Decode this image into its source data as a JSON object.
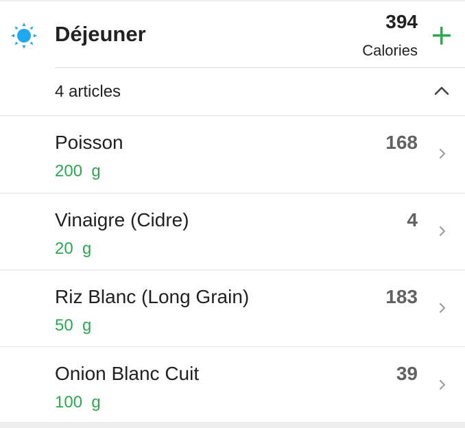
{
  "meal": {
    "title": "Déjeuner",
    "calories_value": "394",
    "calories_unit": "Calories",
    "item_count_label": "4 articles",
    "icon": "sun-icon"
  },
  "colors": {
    "accent_green": "#2ea84f",
    "sun_blue": "#1fa8f0"
  },
  "items": [
    {
      "name": "Poisson",
      "quantity": "200  g",
      "calories": "168"
    },
    {
      "name": "Vinaigre (Cidre)",
      "quantity": "20  g",
      "calories": "4"
    },
    {
      "name": "Riz Blanc (Long Grain)",
      "quantity": "50  g",
      "calories": "183"
    },
    {
      "name": "Onion Blanc Cuit",
      "quantity": "100  g",
      "calories": "39"
    }
  ]
}
